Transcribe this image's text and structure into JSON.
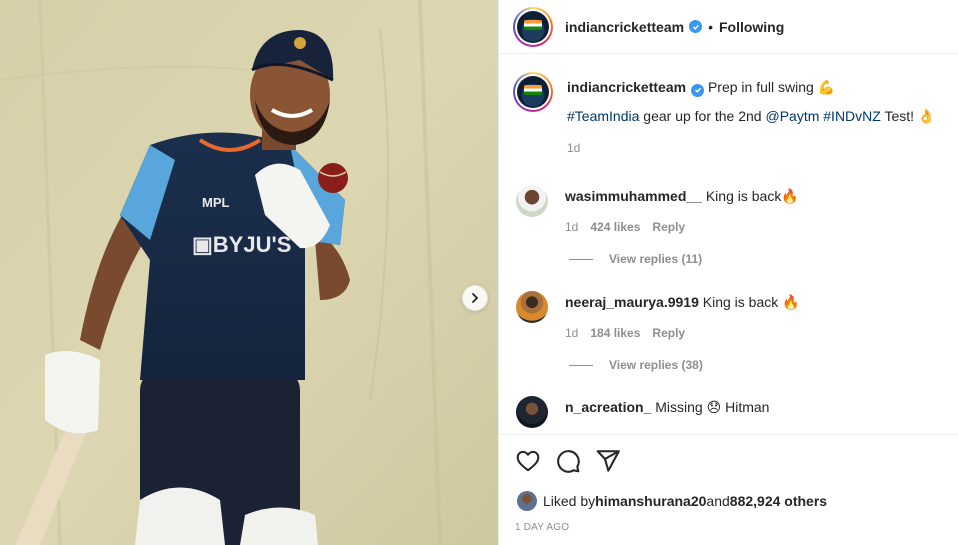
{
  "post": {
    "username": "indiancricketteam",
    "follow_status": "Following",
    "dot": "•",
    "caption_line1": "Prep in full swing 💪",
    "caption_hashtag1": "#TeamIndia",
    "caption_mid": " gear up for the 2nd ",
    "caption_mention": "@Paytm",
    "caption_space": " ",
    "caption_hashtag2": "#INDvNZ",
    "caption_end": " Test! 👌",
    "caption_time": "1d"
  },
  "comments": [
    {
      "username": "wasimmuhammed__",
      "text": "King is back🔥",
      "time": "1d",
      "likes": "424 likes",
      "reply": "Reply",
      "view_replies": "View replies (11)"
    },
    {
      "username": "neeraj_maurya.9919",
      "text": "King is back 🔥",
      "time": "1d",
      "likes": "184 likes",
      "reply": "Reply",
      "view_replies": "View replies (38)"
    },
    {
      "username": "n_acreation_",
      "text": "Missing 😞 Hitman"
    }
  ],
  "likes": {
    "prefix": "Liked by ",
    "user": "himanshurana20",
    "middle": " and ",
    "others": "882,924 others"
  },
  "timestamp": "1 DAY AGO",
  "icons": [
    "verified-icon",
    "heart-icon",
    "comment-icon",
    "share-icon",
    "chevron-right-icon"
  ],
  "colors": {
    "link": "#00376b",
    "verified": "#3897f0",
    "meta": "#8e8e8e"
  }
}
